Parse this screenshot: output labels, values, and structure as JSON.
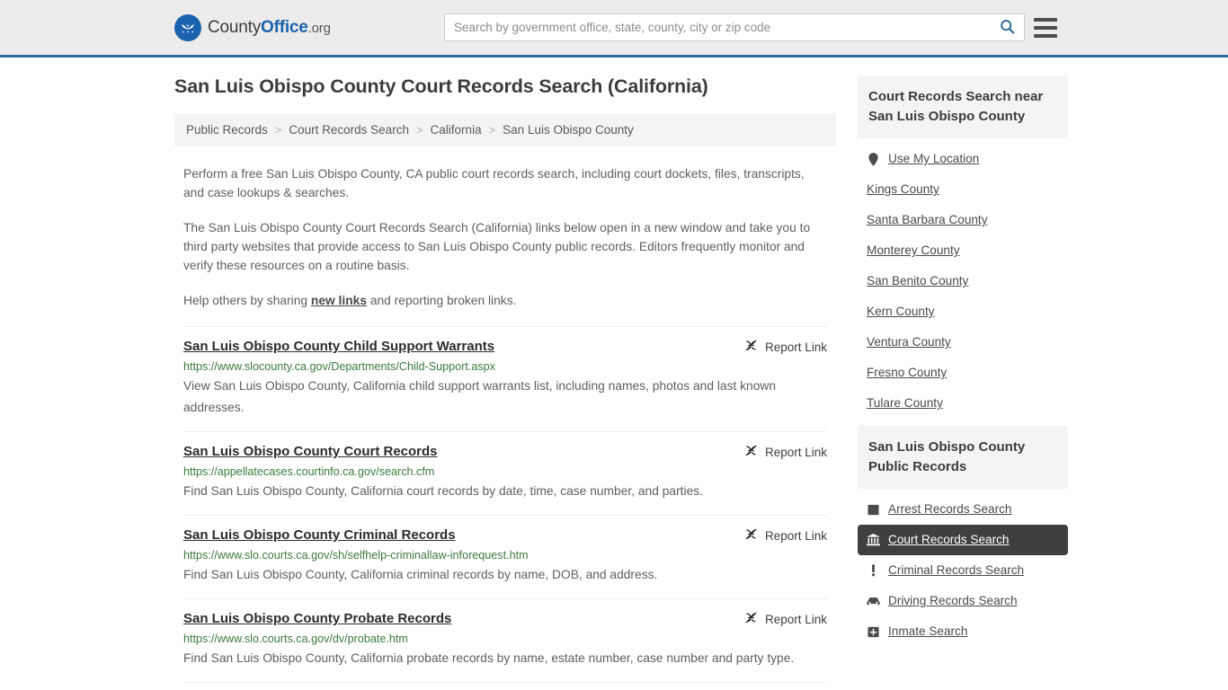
{
  "header": {
    "logo": {
      "text_1": "County",
      "text_2": "Office",
      "text_3": ".org",
      "icon": "eagle-seal-icon"
    },
    "search": {
      "placeholder": "Search by government office, state, county, city or zip code",
      "value": "",
      "icon": "search-icon"
    },
    "menu_icon": "hamburger-menu-icon",
    "accent_color": "#2c6da3",
    "background_color": "#ececec"
  },
  "page_title": "San Luis Obispo County Court Records Search (California)",
  "breadcrumb": {
    "separator": ">",
    "items": [
      {
        "label": "Public Records",
        "current": false
      },
      {
        "label": "Court Records Search",
        "current": false
      },
      {
        "label": "California",
        "current": false
      },
      {
        "label": "San Luis Obispo County",
        "current": true
      }
    ]
  },
  "intro": {
    "paragraph_1": "Perform a free San Luis Obispo County, CA public court records search, including court dockets, files, transcripts, and case lookups & searches.",
    "paragraph_2": "The San Luis Obispo County Court Records Search (California) links below open in a new window and take you to third party websites that provide access to San Luis Obispo County public records. Editors frequently monitor and verify these resources on a routine basis.",
    "paragraph_3_pre": "Help others by sharing ",
    "paragraph_3_link": "new links",
    "paragraph_3_post": " and reporting broken links."
  },
  "report_link": {
    "label": "Report Link",
    "icon": "broken-link-icon"
  },
  "results": [
    {
      "title": "San Luis Obispo County Child Support Warrants",
      "url": "https://www.slocounty.ca.gov/Departments/Child-Support.aspx",
      "description": "View San Luis Obispo County, California child support warrants list, including names, photos and last known addresses."
    },
    {
      "title": "San Luis Obispo County Court Records",
      "url": "https://appellatecases.courtinfo.ca.gov/search.cfm",
      "description": "Find San Luis Obispo County, California court records by date, time, case number, and parties."
    },
    {
      "title": "San Luis Obispo County Criminal Records",
      "url": "https://www.slo.courts.ca.gov/sh/selfhelp-criminallaw-inforequest.htm",
      "description": "Find San Luis Obispo County, California criminal records by name, DOB, and address."
    },
    {
      "title": "San Luis Obispo County Probate Records",
      "url": "https://www.slo.courts.ca.gov/dv/probate.htm",
      "description": "Find San Luis Obispo County, California probate records by name, estate number, case number and party type."
    }
  ],
  "sidebar": {
    "nearby": {
      "heading": "Court Records Search near San Luis Obispo County",
      "items": [
        {
          "label": "Use My Location",
          "icon": "map-pin-icon"
        },
        {
          "label": "Kings County",
          "icon": ""
        },
        {
          "label": "Santa Barbara County",
          "icon": ""
        },
        {
          "label": "Monterey County",
          "icon": ""
        },
        {
          "label": "San Benito County",
          "icon": ""
        },
        {
          "label": "Kern County",
          "icon": ""
        },
        {
          "label": "Ventura County",
          "icon": ""
        },
        {
          "label": "Fresno County",
          "icon": ""
        },
        {
          "label": "Tulare County",
          "icon": ""
        }
      ]
    },
    "public_records": {
      "heading": "San Luis Obispo County Public Records",
      "active_color": "#3f3f3f",
      "items": [
        {
          "label": "Arrest Records Search",
          "icon": "fingerprint-card-icon",
          "active": false
        },
        {
          "label": "Court Records Search",
          "icon": "courthouse-icon",
          "active": true
        },
        {
          "label": "Criminal Records Search",
          "icon": "exclamation-icon",
          "active": false
        },
        {
          "label": "Driving Records Search",
          "icon": "car-icon",
          "active": false
        },
        {
          "label": "Inmate Search",
          "icon": "jail-icon",
          "active": false
        }
      ]
    }
  }
}
